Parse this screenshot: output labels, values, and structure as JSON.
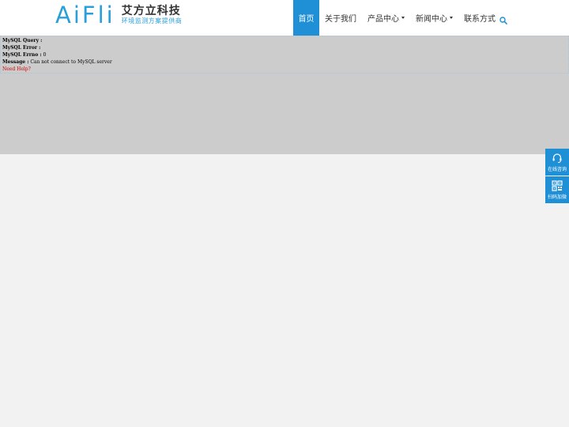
{
  "header": {
    "logo": {
      "mark": "AiFli",
      "name": "艾方立科技",
      "tagline": "环境监测方案提供商"
    },
    "nav": [
      {
        "label": "首页",
        "active": true,
        "dropdown": false
      },
      {
        "label": "关于我们",
        "active": false,
        "dropdown": false
      },
      {
        "label": "产品中心",
        "active": false,
        "dropdown": true
      },
      {
        "label": "新闻中心",
        "active": false,
        "dropdown": true
      },
      {
        "label": "联系方式",
        "active": false,
        "dropdown": false
      }
    ],
    "search_icon": "search-icon"
  },
  "error": {
    "query_label": "MySQL Query :",
    "query_value": "",
    "error_label": "MySQL Error :",
    "error_value": "",
    "errno_label": "MySQL Errno :",
    "errno_value": "0",
    "message_label": "Message :",
    "message_value": "Can not connect to MySQL server",
    "help_link": "Need Help?"
  },
  "side_panel": {
    "online": "在线咨询",
    "qr": "扫码加微"
  },
  "colors": {
    "accent": "#1f8fd6",
    "logo": "#2a9fd8",
    "error_bg": "#cccccc",
    "page_bg": "#f2f2f2",
    "help_link": "#cc0000"
  }
}
